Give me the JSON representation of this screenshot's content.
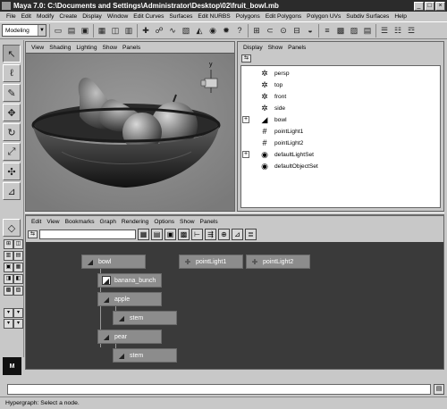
{
  "window": {
    "title": "Maya 7.0: C:\\Documents and Settings\\Administrator\\Desktop\\02\\fruit_bowl.mb",
    "min_glyph": "_",
    "max_glyph": "□",
    "close_glyph": "×"
  },
  "menubar": [
    "File",
    "Edit",
    "Modify",
    "Create",
    "Display",
    "Window",
    "Edit Curves",
    "Surfaces",
    "Edit NURBS",
    "Polygons",
    "Edit Polygons",
    "Polygon UVs",
    "Subdiv Surfaces",
    "Help"
  ],
  "shelf": {
    "mode": "Modeling"
  },
  "viewport": {
    "menu": [
      "View",
      "Shading",
      "Lighting",
      "Show",
      "Panels"
    ],
    "axis_label": "y"
  },
  "outliner": {
    "menu": [
      "Display",
      "Show",
      "Panels"
    ],
    "items": [
      {
        "label": "persp",
        "icon": "camera-icon",
        "glyph": "✲",
        "expandable": false
      },
      {
        "label": "top",
        "icon": "camera-icon",
        "glyph": "✲",
        "expandable": false
      },
      {
        "label": "front",
        "icon": "camera-icon",
        "glyph": "✲",
        "expandable": false
      },
      {
        "label": "side",
        "icon": "camera-icon",
        "glyph": "✲",
        "expandable": false
      },
      {
        "label": "bowl",
        "icon": "nurbs-surface-icon",
        "glyph": "◢",
        "expandable": true
      },
      {
        "label": "pointLight1",
        "icon": "point-light-icon",
        "glyph": "#",
        "expandable": false
      },
      {
        "label": "pointLight2",
        "icon": "point-light-icon",
        "glyph": "#",
        "expandable": false
      },
      {
        "label": "defaultLightSet",
        "icon": "set-icon",
        "glyph": "◉",
        "expandable": true
      },
      {
        "label": "defaultObjectSet",
        "icon": "set-icon",
        "glyph": "◉",
        "expandable": false
      }
    ]
  },
  "hypergraph": {
    "menu": [
      "Edit",
      "View",
      "Bookmarks",
      "Graph",
      "Rendering",
      "Options",
      "Show",
      "Panels"
    ],
    "nodes": {
      "bowl": "bowl",
      "banana_bunch": "banana_bunch",
      "apple": "apple",
      "apple_stem": "stem",
      "pear": "pear",
      "pear_stem": "stem",
      "pointLight1": "pointLight1",
      "pointLight2": "pointLight2"
    }
  },
  "helpline": "Hypergraph: Select a node."
}
